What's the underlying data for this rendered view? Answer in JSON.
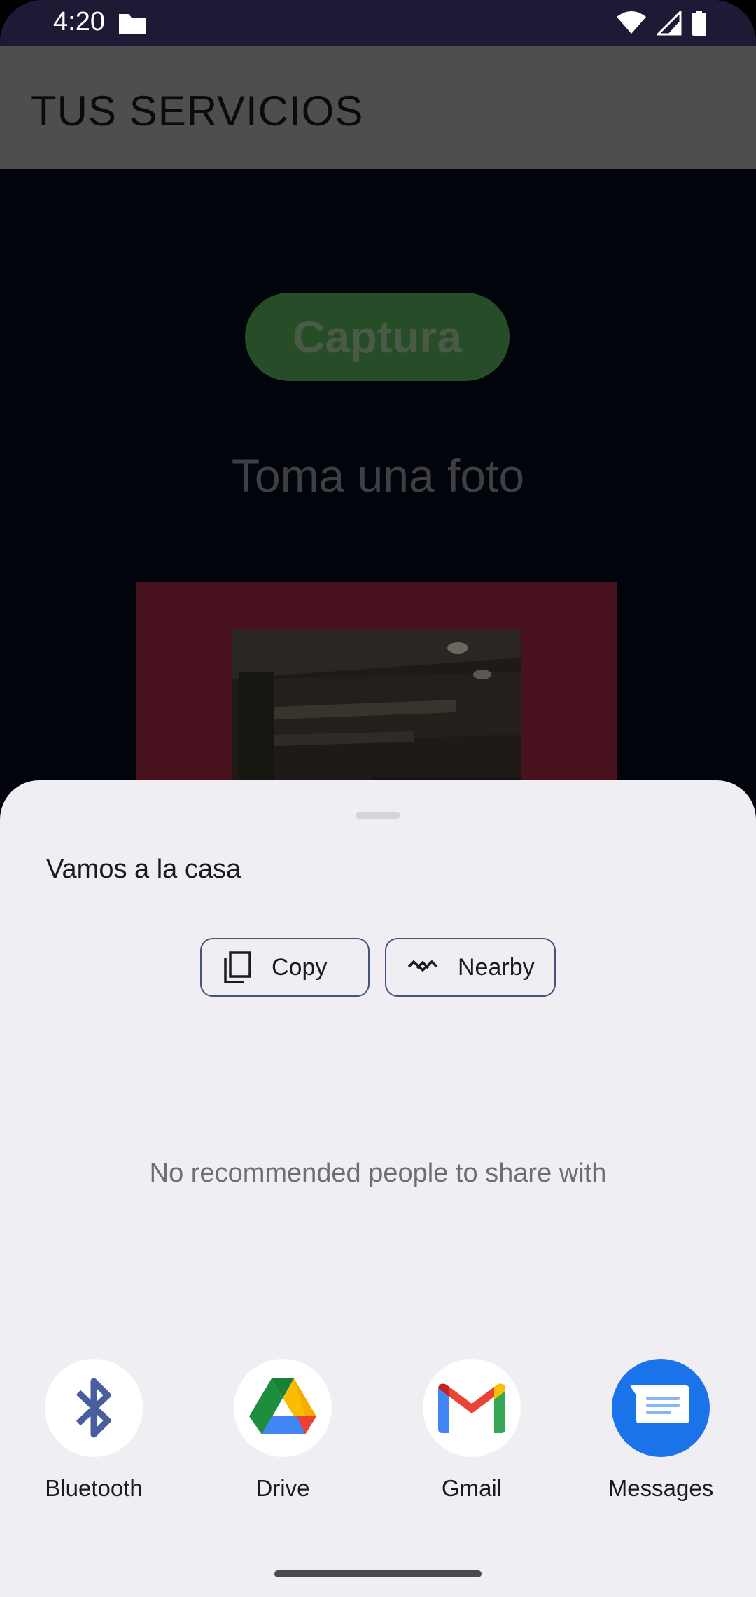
{
  "status_bar": {
    "time": "4:20",
    "icons": [
      "folder-icon",
      "wifi-icon",
      "signal-icon",
      "battery-icon"
    ]
  },
  "app_bar": {
    "title": "TUS SERVICIOS"
  },
  "main": {
    "capture_label": "Captura",
    "photo_prompt": "Toma una foto"
  },
  "share_sheet": {
    "title": "Vamos a la casa",
    "actions": [
      {
        "label": "Copy",
        "icon": "copy-icon"
      },
      {
        "label": "Nearby",
        "icon": "nearby-share-icon"
      }
    ],
    "empty_message": "No recommended people to share with",
    "apps": [
      {
        "label": "Bluetooth",
        "icon": "bluetooth-icon"
      },
      {
        "label": "Drive",
        "icon": "google-drive-icon"
      },
      {
        "label": "Gmail",
        "icon": "gmail-icon"
      },
      {
        "label": "Messages",
        "icon": "messages-icon"
      }
    ]
  },
  "colors": {
    "status_bar_bg": "#1c1a34",
    "app_bar_bg": "#4e4e50",
    "sheet_bg": "#f0eef3",
    "outline_button": "#44527c",
    "messages_blue": "#1a73e8"
  }
}
